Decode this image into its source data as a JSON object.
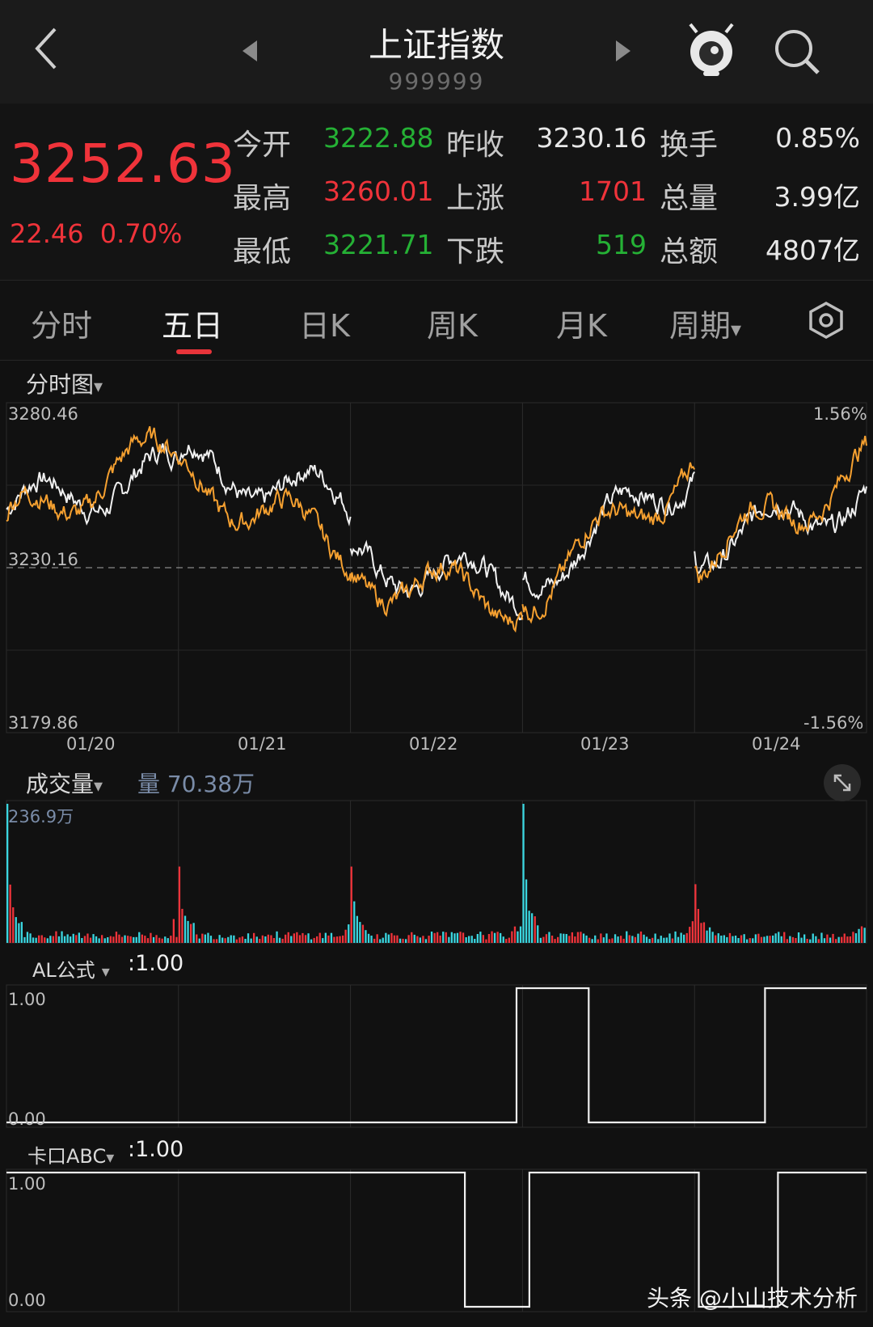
{
  "header": {
    "title": "上证指数",
    "code": "999999"
  },
  "quote": {
    "price": "3252.63",
    "change": "22.46",
    "change_pct": "0.70%",
    "open_label": "今开",
    "open": "3222.88",
    "prev_close_label": "昨收",
    "prev_close": "3230.16",
    "turnover_label": "换手",
    "turnover": "0.85%",
    "high_label": "最高",
    "high": "3260.01",
    "up_label": "上涨",
    "up": "1701",
    "volume_label": "总量",
    "volume": "3.99亿",
    "low_label": "最低",
    "low": "3221.71",
    "down_label": "下跌",
    "down": "519",
    "amount_label": "总额",
    "amount": "4807亿"
  },
  "tabs": [
    {
      "label": "分时"
    },
    {
      "label": "五日"
    },
    {
      "label": "日K"
    },
    {
      "label": "周K"
    },
    {
      "label": "月K"
    },
    {
      "label": "周期"
    }
  ],
  "price_chart": {
    "label": "分时图",
    "y_max": "3280.46",
    "y_mid": "3230.16",
    "y_min": "3179.86",
    "pct_max": "1.56%",
    "pct_min": "-1.56%",
    "dates": [
      "01/20",
      "01/21",
      "01/22",
      "01/23",
      "01/24"
    ]
  },
  "volume_panel": {
    "label": "成交量",
    "summary": "量 70.38万",
    "y_max": "236.9万"
  },
  "al_panel": {
    "label": "AL公式",
    "value": ":1.00",
    "y_top": "1.00",
    "y_bottom": "0.00"
  },
  "kk_panel": {
    "label": "卡口ABC",
    "value": ":1.00",
    "y_top": "1.00",
    "y_bottom": "0.00"
  },
  "watermark": "头条 @小山技术分析",
  "colors": {
    "up": "#f0333a",
    "down": "#25b135",
    "price_line": "#f0f0f0",
    "avg_line": "#f5a030",
    "vol_cyan": "#3ad6e0"
  },
  "chart_data": [
    {
      "type": "line",
      "title": "",
      "xlabel": "",
      "ylabel": "",
      "x": [
        "01/20",
        "01/21",
        "01/22",
        "01/23",
        "01/24"
      ],
      "ylim": [
        3179.86,
        3280.46
      ],
      "series": [
        {
          "name": "",
          "values": [
            3260.0,
            3250.0,
            3225.0,
            3262.0,
            3252.63
          ]
        },
        {
          "name": "",
          "values": [
            3268.0,
            3236.0,
            3220.0,
            3262.0,
            3262.0
          ]
        }
      ]
    },
    {
      "type": "bar",
      "title": "",
      "x": [
        "01/20",
        "01/21",
        "01/22",
        "01/23",
        "01/24"
      ],
      "values_peak": [
        236.9,
        130.0,
        130.0,
        236.9,
        100.0
      ]
    }
  ]
}
